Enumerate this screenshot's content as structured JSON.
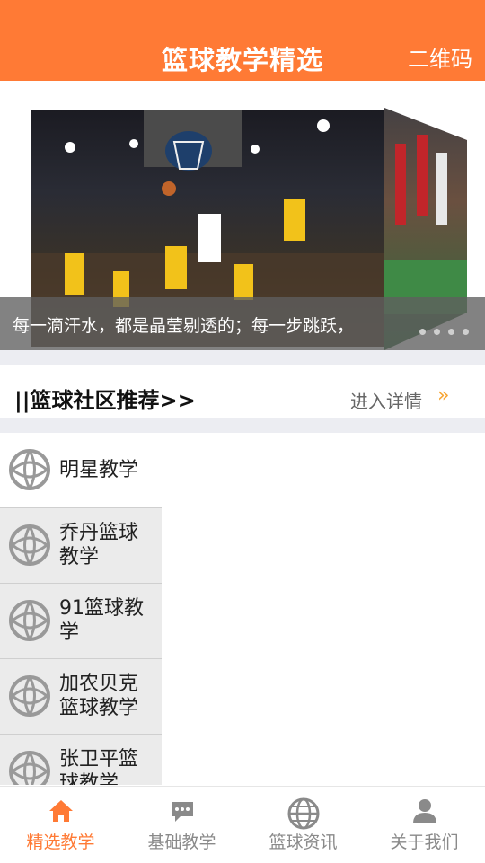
{
  "header": {
    "title": "篮球教学精选",
    "qr_label": "二维码"
  },
  "banner": {
    "caption": "每一滴汗水，都是晶莹剔透的；每一步跳跃，"
  },
  "section": {
    "title": "||篮球社区推荐>>",
    "more_label": "进入详情",
    "more_arrow": "»"
  },
  "categories": [
    {
      "label": "明星教学",
      "selected": true
    },
    {
      "label": "乔丹篮球\n教学",
      "selected": false
    },
    {
      "label": "91篮球教\n学",
      "selected": false
    },
    {
      "label": "加农贝克\n篮球教学",
      "selected": false
    },
    {
      "label": "张卫平篮\n球教学",
      "selected": false
    }
  ],
  "tabs": [
    {
      "label": "精选教学",
      "icon": "home-icon",
      "active": true
    },
    {
      "label": "基础教学",
      "icon": "chat-bubble-icon",
      "active": false
    },
    {
      "label": "篮球资讯",
      "icon": "globe-icon",
      "active": false
    },
    {
      "label": "关于我们",
      "icon": "user-icon",
      "active": false
    }
  ],
  "colors": {
    "accent": "#ff7a35",
    "tab_inactive": "#8a8a8a",
    "arrow": "#f7a534"
  }
}
